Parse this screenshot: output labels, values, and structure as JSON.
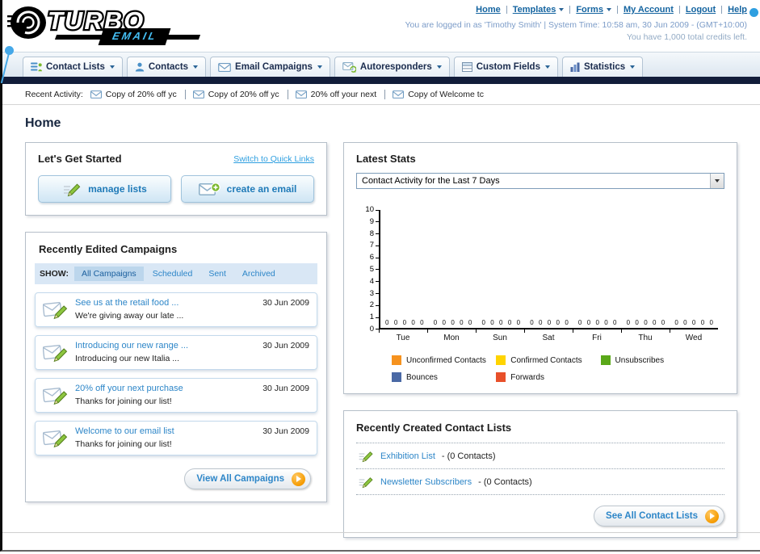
{
  "header": {
    "logo_line1": "TURBO",
    "logo_line2": "EMAIL",
    "login_info": "You are logged in as 'Timothy Smith' | System Time: 10:58 am, 30 Jun 2009 - (GMT+10:00)",
    "credits": "You have 1,000 total credits left."
  },
  "top_nav": [
    {
      "label": "Home",
      "has_menu": false
    },
    {
      "label": "Templates",
      "has_menu": true
    },
    {
      "label": "Forms",
      "has_menu": true
    },
    {
      "label": "My Account",
      "has_menu": false
    },
    {
      "label": "Logout",
      "has_menu": false
    },
    {
      "label": "Help",
      "has_menu": false
    }
  ],
  "main_nav": [
    {
      "label": "Contact Lists"
    },
    {
      "label": "Contacts"
    },
    {
      "label": "Email Campaigns"
    },
    {
      "label": "Autoresponders"
    },
    {
      "label": "Custom Fields"
    },
    {
      "label": "Statistics"
    }
  ],
  "recent_activity": {
    "label": "Recent Activity:",
    "items": [
      {
        "title": "Copy of 20% off yc"
      },
      {
        "title": "Copy of 20% off yc"
      },
      {
        "title": "20% off your next"
      },
      {
        "title": "Copy of Welcome tc"
      }
    ]
  },
  "page": {
    "title": "Home"
  },
  "get_started": {
    "title": "Let's Get Started",
    "switch_link": "Switch to Quick Links",
    "manage_lists_label": "manage lists",
    "create_email_label": "create an email"
  },
  "campaigns": {
    "title": "Recently Edited Campaigns",
    "show_label": "SHOW:",
    "filters": [
      {
        "label": "All Campaigns",
        "selected": true
      },
      {
        "label": "Scheduled",
        "selected": false
      },
      {
        "label": "Sent",
        "selected": false
      },
      {
        "label": "Archived",
        "selected": false
      }
    ],
    "items": [
      {
        "title": "See us at the retail food ...",
        "subtitle": "We're giving away our late ...",
        "date": "30 Jun 2009"
      },
      {
        "title": "Introducing our new range ...",
        "subtitle": "Introducing our new Italia ...",
        "date": "30 Jun 2009"
      },
      {
        "title": "20% off your next purchase",
        "subtitle": "Thanks for joining our list!",
        "date": "30 Jun 2009"
      },
      {
        "title": "Welcome to our email list",
        "subtitle": "Thanks for joining our list!",
        "date": "30 Jun 2009"
      }
    ],
    "view_all_label": "View All Campaigns"
  },
  "stats": {
    "title": "Latest Stats",
    "period_selected": "Contact Activity for the Last 7 Days"
  },
  "chart_data": {
    "type": "bar",
    "title": "Contact Activity for the Last 7 Days",
    "categories": [
      "Tue",
      "Mon",
      "Sun",
      "Sat",
      "Fri",
      "Thu",
      "Wed"
    ],
    "series": [
      {
        "name": "Unconfirmed Contacts",
        "color": "#f6921e",
        "values": [
          0,
          0,
          0,
          0,
          0,
          0,
          0
        ]
      },
      {
        "name": "Confirmed Contacts",
        "color": "#ffd400",
        "values": [
          0,
          0,
          0,
          0,
          0,
          0,
          0
        ]
      },
      {
        "name": "Unsubscribes",
        "color": "#5aa819",
        "values": [
          0,
          0,
          0,
          0,
          0,
          0,
          0
        ]
      },
      {
        "name": "Bounces",
        "color": "#4a69a5",
        "values": [
          0,
          0,
          0,
          0,
          0,
          0,
          0
        ]
      },
      {
        "name": "Forwards",
        "color": "#e8502a",
        "values": [
          0,
          0,
          0,
          0,
          0,
          0,
          0
        ]
      }
    ],
    "ylim": [
      0,
      10
    ],
    "xlabel": "",
    "ylabel": "",
    "grid": false,
    "legend_position": "bottom"
  },
  "contact_lists": {
    "title": "Recently Created Contact Lists",
    "items": [
      {
        "name": "Exhibition List",
        "count": "- (0 Contacts)"
      },
      {
        "name": "Newsletter Subscribers",
        "count": "- (0 Contacts)"
      }
    ],
    "see_all_label": "See All Contact Lists"
  }
}
